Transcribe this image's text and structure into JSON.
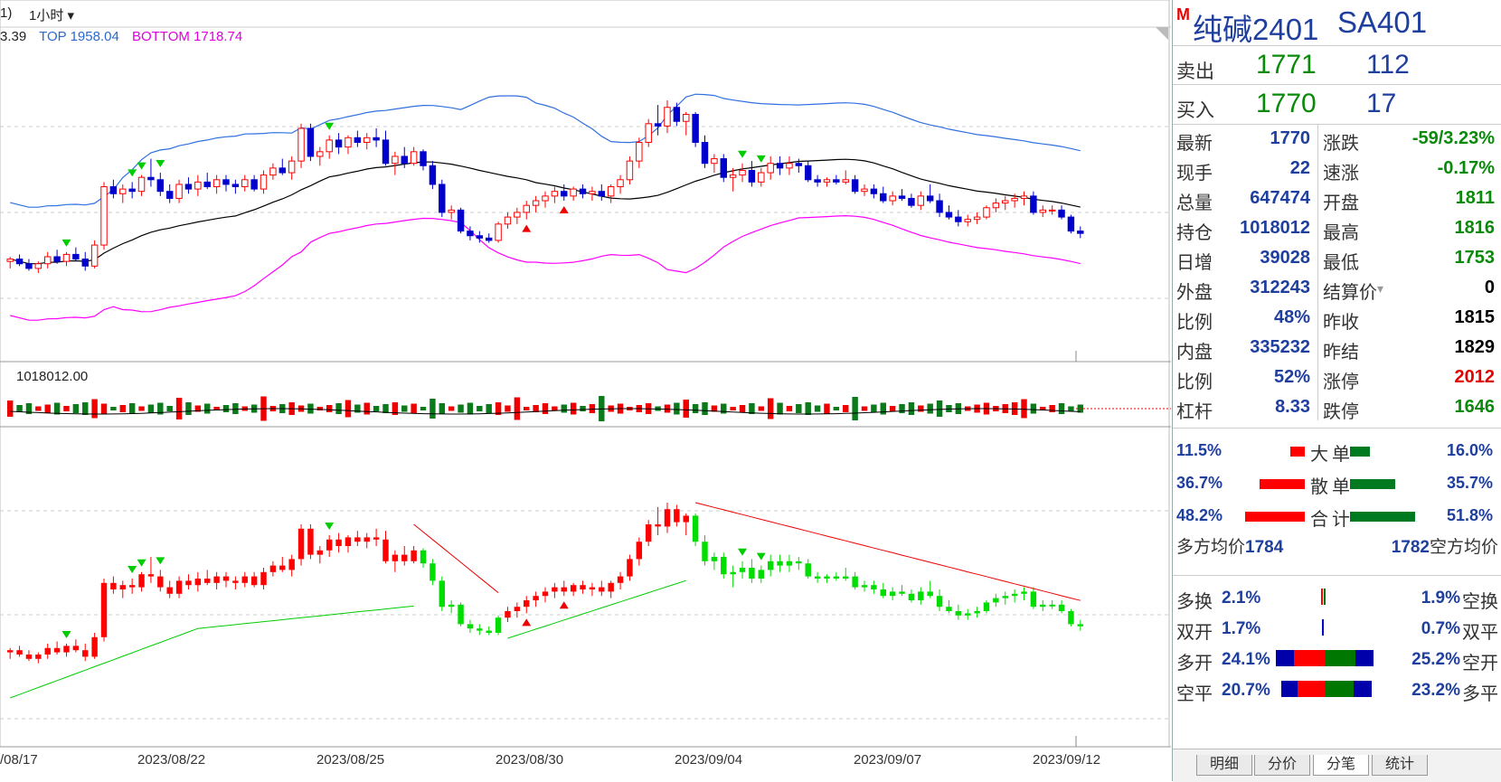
{
  "toolbar": {
    "left_frag": "1)",
    "period": "1小时",
    "period_arrow": "▾"
  },
  "legend": {
    "val": "3.39",
    "top": "TOP 1958.04",
    "bottom": "BOTTOM 1718.74"
  },
  "vol_label": "1018012.00",
  "dates": [
    "/08/17",
    "2023/08/22",
    "2023/08/25",
    "2023/08/30",
    "2023/09/04",
    "2023/09/07",
    "2023/09/12"
  ],
  "colors": {
    "up": "#ff0000",
    "down": "#0000cc",
    "ma": "#000000",
    "top": "#3070e0",
    "bottom": "#ff00ff",
    "green": "#00dd00",
    "dkgreen": "#007a20"
  },
  "quote": {
    "m": "M",
    "name": "纯碱2401",
    "code": "SA401",
    "sell_label": "卖出",
    "sell_price": "1771",
    "sell_vol": "112",
    "buy_label": "买入",
    "buy_price": "1770",
    "buy_vol": "17"
  },
  "stats": [
    {
      "l1": "最新",
      "v1": "1770",
      "l2": "涨跌",
      "v2": "-59/3.23%",
      "c2": "#0a8a0a"
    },
    {
      "l1": "现手",
      "v1": "22",
      "l2": "速涨",
      "v2": "-0.17%",
      "c2": "#0a8a0a"
    },
    {
      "l1": "总量",
      "v1": "647474",
      "l2": "开盘",
      "v2": "1811",
      "c2": "#0a8a0a"
    },
    {
      "l1": "持仓",
      "v1": "1018012",
      "l2": "最高",
      "v2": "1816",
      "c2": "#0a8a0a"
    },
    {
      "l1": "日增",
      "v1": "39028",
      "l2": "最低",
      "v2": "1753",
      "c2": "#0a8a0a"
    },
    {
      "l1": "外盘",
      "v1": "312243",
      "l2": "结算价",
      "v2": "0",
      "c2": "#000000"
    },
    {
      "l1": "比例",
      "v1": "48%",
      "l2": "昨收",
      "v2": "1815",
      "c2": "#000000"
    },
    {
      "l1": "内盘",
      "v1": "335232",
      "l2": "昨结",
      "v2": "1829",
      "c2": "#000000"
    },
    {
      "l1": "比例",
      "v1": "52%",
      "l2": "涨停",
      "v2": "2012",
      "c2": "#e00000"
    },
    {
      "l1": "杠杆",
      "v1": "8.33",
      "l2": "跌停",
      "v2": "1646",
      "c2": "#0a8a0a"
    }
  ],
  "orders": [
    {
      "lp": "11.5%",
      "cap": "大单",
      "rp": "16.0%",
      "rw": 16,
      "gw": 22
    },
    {
      "lp": "36.7%",
      "cap": "散单",
      "rp": "35.7%",
      "rw": 50,
      "gw": 50
    },
    {
      "lp": "48.2%",
      "cap": "合计",
      "rp": "51.8%",
      "rw": 66,
      "gw": 72
    }
  ],
  "avg": {
    "long_label": "多方均价",
    "long_val": "1784",
    "short_val": "1782",
    "short_label": "空方均价"
  },
  "flow": [
    {
      "l": "多换",
      "v": "2.1%",
      "v2": "1.9%",
      "r": "空换"
    },
    {
      "l": "双开",
      "v": "1.7%",
      "v2": "0.7%",
      "r": "双平"
    },
    {
      "l": "多开",
      "v": "24.1%",
      "v2": "25.2%",
      "r": "空开"
    },
    {
      "l": "空平",
      "v": "20.7%",
      "v2": "23.2%",
      "r": "多平"
    }
  ],
  "tabs": [
    "明细",
    "分价",
    "分笔",
    "统计"
  ],
  "candles": [
    [
      1782,
      1786,
      1776,
      1784
    ],
    [
      1784,
      1788,
      1778,
      1780
    ],
    [
      1780,
      1784,
      1774,
      1776
    ],
    [
      1776,
      1782,
      1772,
      1780
    ],
    [
      1780,
      1790,
      1776,
      1786
    ],
    [
      1786,
      1792,
      1780,
      1782
    ],
    [
      1782,
      1790,
      1778,
      1788
    ],
    [
      1788,
      1794,
      1782,
      1784
    ],
    [
      1784,
      1790,
      1774,
      1778
    ],
    [
      1778,
      1800,
      1776,
      1796
    ],
    [
      1796,
      1850,
      1792,
      1846
    ],
    [
      1846,
      1852,
      1836,
      1840
    ],
    [
      1840,
      1848,
      1832,
      1844
    ],
    [
      1844,
      1850,
      1836,
      1842
    ],
    [
      1842,
      1856,
      1838,
      1854
    ],
    [
      1854,
      1870,
      1846,
      1852
    ],
    [
      1852,
      1858,
      1838,
      1842
    ],
    [
      1842,
      1848,
      1832,
      1836
    ],
    [
      1836,
      1852,
      1832,
      1848
    ],
    [
      1848,
      1854,
      1840,
      1844
    ],
    [
      1844,
      1856,
      1838,
      1850
    ],
    [
      1850,
      1858,
      1844,
      1846
    ],
    [
      1846,
      1856,
      1840,
      1852
    ],
    [
      1852,
      1856,
      1842,
      1848
    ],
    [
      1848,
      1852,
      1840,
      1846
    ],
    [
      1846,
      1856,
      1842,
      1852
    ],
    [
      1852,
      1856,
      1842,
      1844
    ],
    [
      1844,
      1860,
      1840,
      1856
    ],
    [
      1856,
      1866,
      1852,
      1862
    ],
    [
      1862,
      1870,
      1856,
      1858
    ],
    [
      1858,
      1872,
      1852,
      1868
    ],
    [
      1868,
      1900,
      1862,
      1896
    ],
    [
      1896,
      1900,
      1868,
      1872
    ],
    [
      1872,
      1880,
      1864,
      1876
    ],
    [
      1876,
      1890,
      1870,
      1886
    ],
    [
      1886,
      1892,
      1874,
      1880
    ],
    [
      1880,
      1890,
      1874,
      1888
    ],
    [
      1888,
      1894,
      1880,
      1884
    ],
    [
      1884,
      1892,
      1878,
      1888
    ],
    [
      1888,
      1896,
      1880,
      1886
    ],
    [
      1886,
      1894,
      1864,
      1866
    ],
    [
      1866,
      1876,
      1856,
      1872
    ],
    [
      1872,
      1880,
      1862,
      1866
    ],
    [
      1866,
      1880,
      1864,
      1876
    ],
    [
      1876,
      1878,
      1860,
      1864
    ],
    [
      1864,
      1868,
      1844,
      1848
    ],
    [
      1848,
      1852,
      1820,
      1824
    ],
    [
      1824,
      1830,
      1818,
      1826
    ],
    [
      1826,
      1828,
      1806,
      1808
    ],
    [
      1808,
      1812,
      1800,
      1804
    ],
    [
      1804,
      1808,
      1798,
      1802
    ],
    [
      1802,
      1806,
      1798,
      1800
    ],
    [
      1800,
      1816,
      1798,
      1814
    ],
    [
      1814,
      1824,
      1810,
      1820
    ],
    [
      1820,
      1828,
      1814,
      1824
    ],
    [
      1824,
      1834,
      1818,
      1830
    ],
    [
      1830,
      1838,
      1824,
      1834
    ],
    [
      1834,
      1842,
      1828,
      1838
    ],
    [
      1838,
      1846,
      1832,
      1842
    ],
    [
      1842,
      1848,
      1834,
      1838
    ],
    [
      1838,
      1846,
      1834,
      1844
    ],
    [
      1844,
      1848,
      1836,
      1840
    ],
    [
      1840,
      1846,
      1834,
      1842
    ],
    [
      1842,
      1848,
      1834,
      1838
    ],
    [
      1838,
      1848,
      1832,
      1846
    ],
    [
      1846,
      1856,
      1840,
      1852
    ],
    [
      1852,
      1872,
      1848,
      1868
    ],
    [
      1868,
      1888,
      1862,
      1884
    ],
    [
      1884,
      1904,
      1880,
      1900
    ],
    [
      1900,
      1916,
      1890,
      1898
    ],
    [
      1898,
      1920,
      1892,
      1914
    ],
    [
      1914,
      1918,
      1898,
      1902
    ],
    [
      1902,
      1910,
      1890,
      1908
    ],
    [
      1908,
      1910,
      1880,
      1884
    ],
    [
      1884,
      1890,
      1862,
      1866
    ],
    [
      1866,
      1874,
      1858,
      1870
    ],
    [
      1870,
      1874,
      1850,
      1854
    ],
    [
      1854,
      1862,
      1842,
      1856
    ],
    [
      1856,
      1866,
      1850,
      1860
    ],
    [
      1860,
      1868,
      1846,
      1850
    ],
    [
      1850,
      1862,
      1846,
      1858
    ],
    [
      1858,
      1872,
      1852,
      1866
    ],
    [
      1866,
      1872,
      1856,
      1862
    ],
    [
      1862,
      1872,
      1856,
      1866
    ],
    [
      1866,
      1870,
      1858,
      1864
    ],
    [
      1864,
      1868,
      1850,
      1852
    ],
    [
      1852,
      1856,
      1846,
      1850
    ],
    [
      1850,
      1854,
      1846,
      1852
    ],
    [
      1852,
      1856,
      1848,
      1850
    ],
    [
      1850,
      1860,
      1848,
      1852
    ],
    [
      1852,
      1856,
      1840,
      1842
    ],
    [
      1842,
      1848,
      1838,
      1844
    ],
    [
      1844,
      1848,
      1836,
      1840
    ],
    [
      1840,
      1846,
      1832,
      1834
    ],
    [
      1834,
      1842,
      1830,
      1838
    ],
    [
      1838,
      1844,
      1834,
      1836
    ],
    [
      1836,
      1840,
      1828,
      1830
    ],
    [
      1830,
      1842,
      1826,
      1838
    ],
    [
      1838,
      1848,
      1832,
      1834
    ],
    [
      1834,
      1840,
      1820,
      1824
    ],
    [
      1824,
      1830,
      1818,
      1820
    ],
    [
      1820,
      1826,
      1812,
      1816
    ],
    [
      1816,
      1822,
      1812,
      1818
    ],
    [
      1818,
      1824,
      1814,
      1820
    ],
    [
      1820,
      1830,
      1818,
      1828
    ],
    [
      1828,
      1836,
      1824,
      1832
    ],
    [
      1832,
      1838,
      1826,
      1834
    ],
    [
      1834,
      1840,
      1828,
      1836
    ],
    [
      1836,
      1842,
      1830,
      1838
    ],
    [
      1838,
      1842,
      1822,
      1824
    ],
    [
      1824,
      1830,
      1820,
      1826
    ],
    [
      1826,
      1830,
      1822,
      1826
    ],
    [
      1826,
      1830,
      1818,
      1820
    ],
    [
      1820,
      1822,
      1806,
      1808
    ],
    [
      1808,
      1812,
      1802,
      1806
    ]
  ],
  "markers": [
    {
      "i": 6,
      "kind": "down"
    },
    {
      "i": 13,
      "kind": "down"
    },
    {
      "i": 14,
      "kind": "down"
    },
    {
      "i": 16,
      "kind": "down"
    },
    {
      "i": 34,
      "kind": "down"
    },
    {
      "i": 55,
      "kind": "up"
    },
    {
      "i": 59,
      "kind": "up"
    },
    {
      "i": 78,
      "kind": "down"
    },
    {
      "i": 80,
      "kind": "down"
    }
  ]
}
